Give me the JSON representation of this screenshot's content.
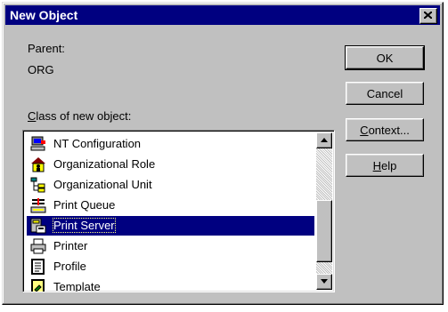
{
  "dialog": {
    "title": "New Object",
    "close_icon": "close-icon"
  },
  "parent": {
    "label": "Parent:",
    "value": "ORG"
  },
  "class_list": {
    "label": "Class of new object:",
    "items": [
      {
        "label": "NT Configuration",
        "icon": "nt-configuration-icon"
      },
      {
        "label": "Organizational Role",
        "icon": "organizational-role-icon"
      },
      {
        "label": "Organizational Unit",
        "icon": "organizational-unit-icon"
      },
      {
        "label": "Print Queue",
        "icon": "print-queue-icon"
      },
      {
        "label": "Print Server",
        "icon": "print-server-icon",
        "selected": true
      },
      {
        "label": "Printer",
        "icon": "printer-icon"
      },
      {
        "label": "Profile",
        "icon": "profile-icon"
      },
      {
        "label": "Template",
        "icon": "template-icon"
      }
    ]
  },
  "buttons": {
    "ok": "OK",
    "cancel": "Cancel",
    "context": "Context...",
    "help": "Help"
  },
  "colors": {
    "face": "#c0c0c0",
    "titlebar": "#000080",
    "selection": "#000080"
  }
}
